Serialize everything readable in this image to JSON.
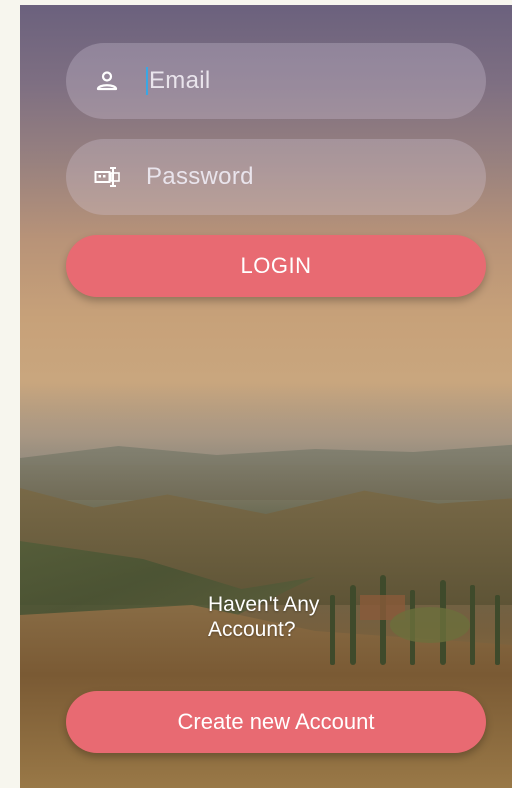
{
  "login_form": {
    "email_placeholder": "Email",
    "password_placeholder": "Password",
    "login_label": "LOGIN",
    "email_icon": "person-icon",
    "password_icon": "password-icon"
  },
  "signup": {
    "prompt_line1": "Haven't Any",
    "prompt_line2": "Account?",
    "create_label": "Create new Account"
  },
  "colors": {
    "accent": "#e86a72",
    "caret": "#39a7e4",
    "page_background": "#f7f6ee"
  }
}
